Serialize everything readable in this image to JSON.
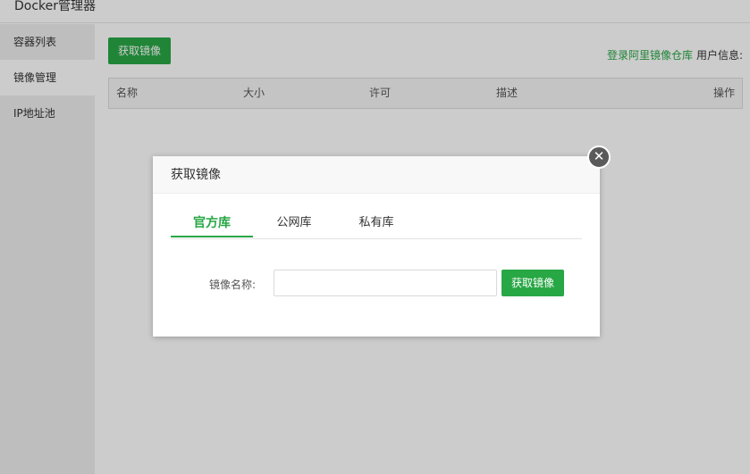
{
  "app": {
    "title": "Docker管理器"
  },
  "sidebar": {
    "items": [
      {
        "label": "容器列表"
      },
      {
        "label": "镜像管理"
      },
      {
        "label": "IP地址池"
      }
    ]
  },
  "toolbar": {
    "fetch_label": "获取镜像",
    "aliyun_link": "登录阿里镜像仓库",
    "user_info": "用户信息:"
  },
  "table": {
    "columns": [
      "名称",
      "大小",
      "许可",
      "描述",
      "操作"
    ]
  },
  "dialog": {
    "title": "获取镜像",
    "close_glyph": "✕",
    "tabs": [
      {
        "label": "官方库",
        "active": true
      },
      {
        "label": "公网库",
        "active": false
      },
      {
        "label": "私有库",
        "active": false
      }
    ],
    "image_name_label": "镜像名称:",
    "image_name_value": "",
    "fetch_label": "获取镜像"
  },
  "colors": {
    "accent": "#28a745",
    "sidebar_bg": "#eeeeee",
    "overlay": "rgba(0,0,0,0.2)"
  },
  "icons": {
    "close": "close-icon"
  }
}
